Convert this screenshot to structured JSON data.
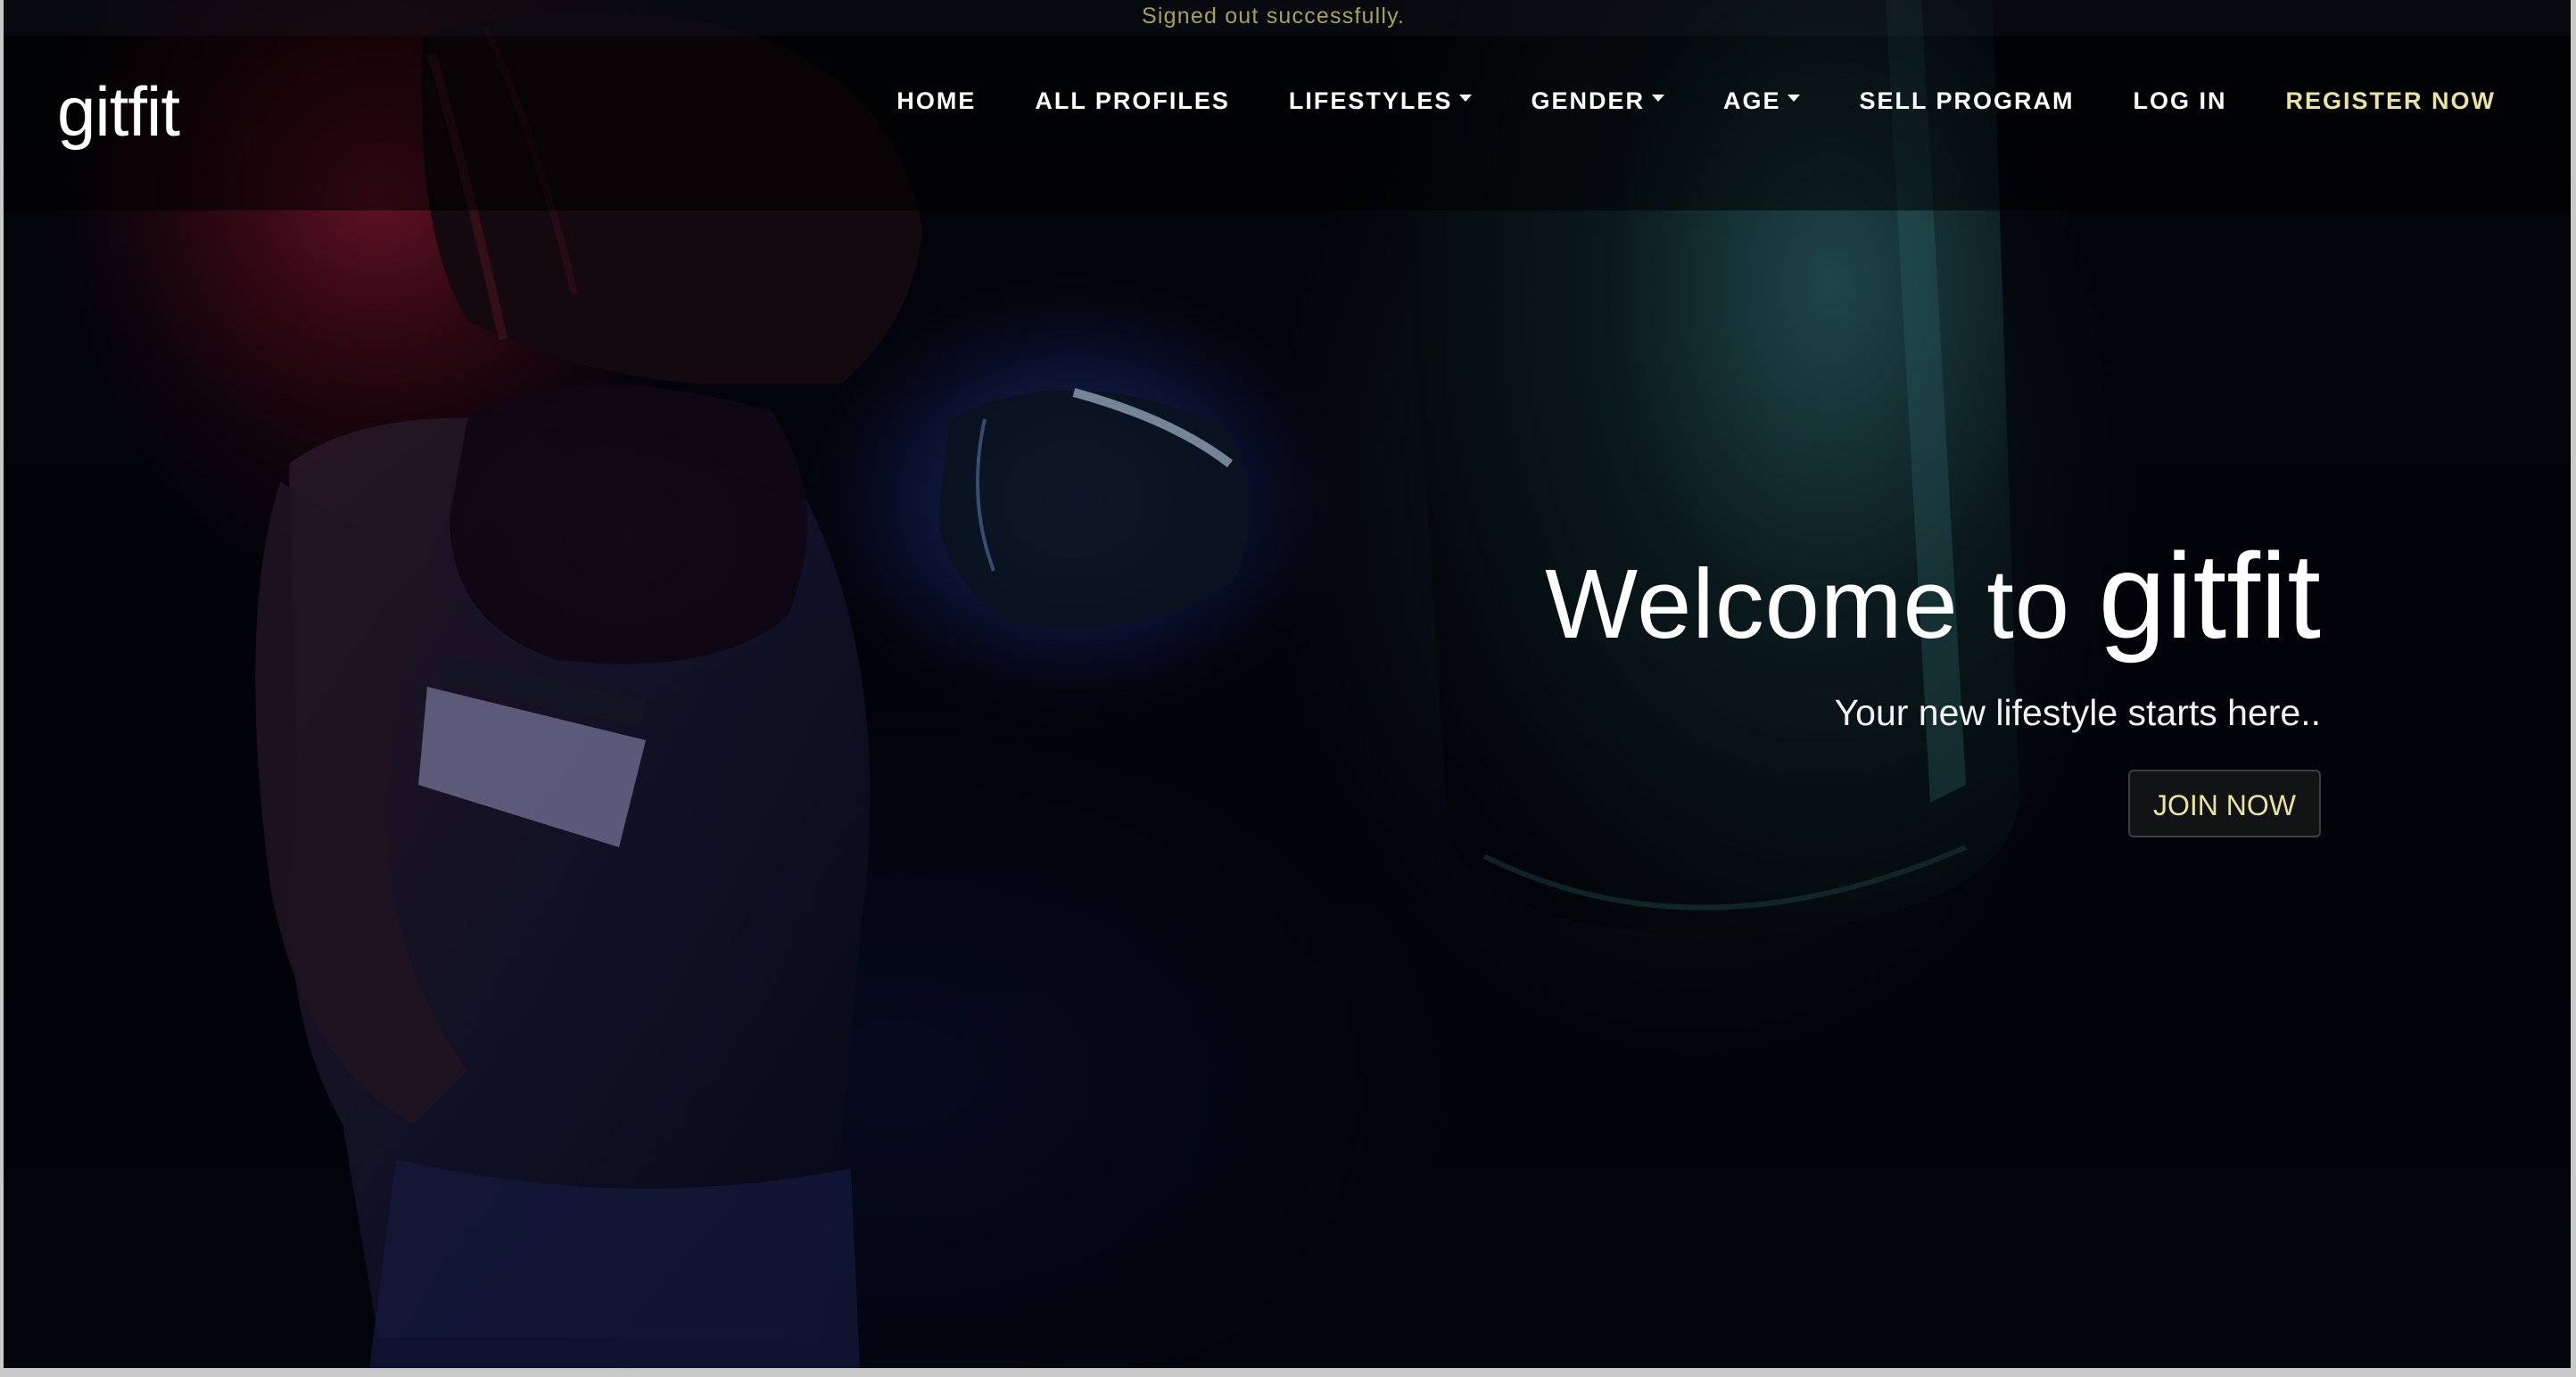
{
  "flash": {
    "message": "Signed out successfully."
  },
  "navbar": {
    "brand": "gitfit",
    "items": [
      {
        "label": "HOME",
        "dropdown": false,
        "highlight": false
      },
      {
        "label": "ALL PROFILES",
        "dropdown": false,
        "highlight": false
      },
      {
        "label": "LIFESTYLES",
        "dropdown": true,
        "highlight": false
      },
      {
        "label": "GENDER",
        "dropdown": true,
        "highlight": false
      },
      {
        "label": "AGE",
        "dropdown": true,
        "highlight": false
      },
      {
        "label": "SELL PROGRAM",
        "dropdown": false,
        "highlight": false
      },
      {
        "label": "LOG IN",
        "dropdown": false,
        "highlight": false
      },
      {
        "label": "REGISTER NOW",
        "dropdown": false,
        "highlight": true
      }
    ]
  },
  "hero": {
    "title_prefix": "Welcome to",
    "title_brand": "gitfit",
    "subtitle": "Your new lifestyle starts here..",
    "cta_label": "JOIN NOW"
  },
  "colors": {
    "accent": "#e8e3a0",
    "flash_text": "#a4a35a",
    "background": "#03060d"
  },
  "background_image": "boxer-punching-bag-icon"
}
